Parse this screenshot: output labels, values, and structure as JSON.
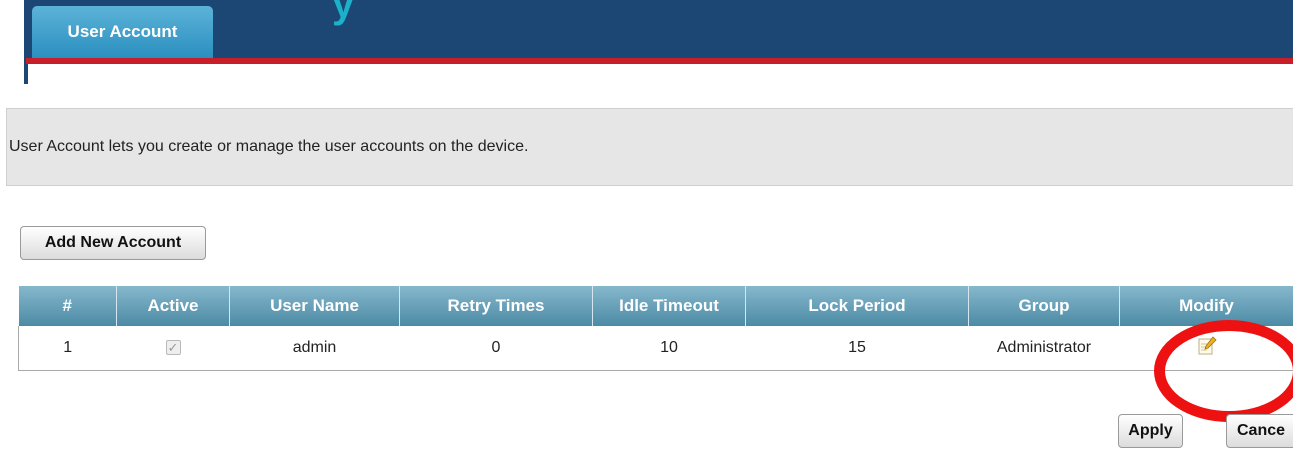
{
  "header": {
    "tab_label": "User Account",
    "partial_glyph": "y"
  },
  "description": "User Account lets you create or manage the user accounts on the device.",
  "add_button": "Add New Account",
  "table": {
    "columns": [
      "#",
      "Active",
      "User Name",
      "Retry Times",
      "Idle Timeout",
      "Lock Period",
      "Group",
      "Modify"
    ],
    "rows": [
      {
        "index": "1",
        "active": true,
        "user_name": "admin",
        "retry_times": "0",
        "idle_timeout": "10",
        "lock_period": "15",
        "group": "Administrator"
      }
    ]
  },
  "footer": {
    "apply_label": "Apply",
    "cancel_label": "Cance"
  },
  "colors": {
    "header_bg": "#1c4673",
    "header_accent": "#c81e2a",
    "tab": "#3a9ccc",
    "table_header": "#5f98b0",
    "highlight_ring": "#ee1111"
  },
  "icons": {
    "modify": "edit-icon",
    "active": "checkbox-checked-icon"
  }
}
